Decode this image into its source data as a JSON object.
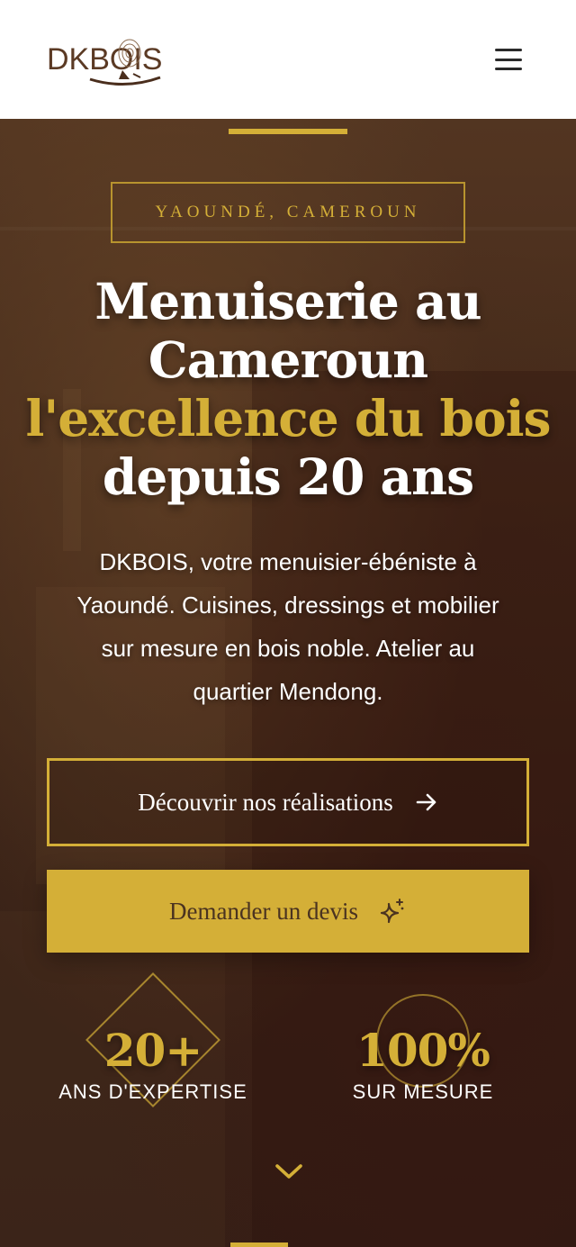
{
  "header": {
    "logo_text": "DKBOIS",
    "menu_icon": "hamburger-menu-icon"
  },
  "hero": {
    "location_badge": "YAOUNDÉ, CAMEROUN",
    "title_line1": "Menuiserie au",
    "title_line2": "Cameroun",
    "title_highlight": "l'excellence du bois",
    "title_line4": "depuis 20 ans",
    "subtitle_line1": "DKBOIS, votre menuisier-ébéniste à",
    "subtitle_line2": "Yaoundé. Cuisines, dressings et mobilier",
    "subtitle_line3": "sur mesure en bois noble. Atelier au",
    "subtitle_line4": "quartier Mendong.",
    "primary_button": "Découvrir nos réalisations",
    "secondary_button": "Demander un devis",
    "stats": [
      {
        "value": "20+",
        "label": "ANS D'EXPERTISE"
      },
      {
        "value": "100%",
        "label": "SUR MESURE"
      }
    ]
  },
  "colors": {
    "accent_gold": "#d4af37",
    "brown_dark": "#3a2418",
    "logo_brown": "#5b3a24"
  },
  "icons": {
    "arrow": "arrow-right-icon",
    "sparkle": "sparkle-icon",
    "scroll": "chevron-down-icon"
  }
}
